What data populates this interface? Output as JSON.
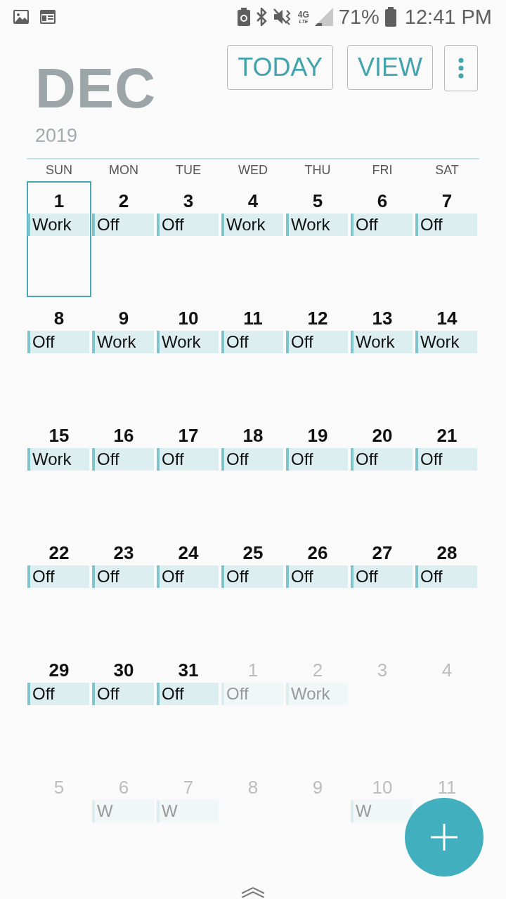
{
  "status_bar": {
    "network_top": "4G",
    "network_bottom": "LTE",
    "battery": "71%",
    "time": "12:41 PM"
  },
  "header": {
    "month": "DEC",
    "year": "2019",
    "buttons": [
      "TODAY",
      "VIEW"
    ]
  },
  "weekdays": [
    "SUN",
    "MON",
    "TUE",
    "WED",
    "THU",
    "FRI",
    "SAT"
  ],
  "weeks": [
    [
      {
        "day": "1",
        "in_month": true,
        "selected": true,
        "event": "Work"
      },
      {
        "day": "2",
        "in_month": true,
        "selected": false,
        "event": "Off"
      },
      {
        "day": "3",
        "in_month": true,
        "selected": false,
        "event": "Off"
      },
      {
        "day": "4",
        "in_month": true,
        "selected": false,
        "event": "Work"
      },
      {
        "day": "5",
        "in_month": true,
        "selected": false,
        "event": "Work"
      },
      {
        "day": "6",
        "in_month": true,
        "selected": false,
        "event": "Off"
      },
      {
        "day": "7",
        "in_month": true,
        "selected": false,
        "event": "Off"
      }
    ],
    [
      {
        "day": "8",
        "in_month": true,
        "selected": false,
        "event": "Off"
      },
      {
        "day": "9",
        "in_month": true,
        "selected": false,
        "event": "Work"
      },
      {
        "day": "10",
        "in_month": true,
        "selected": false,
        "event": "Work"
      },
      {
        "day": "11",
        "in_month": true,
        "selected": false,
        "event": "Off"
      },
      {
        "day": "12",
        "in_month": true,
        "selected": false,
        "event": "Off"
      },
      {
        "day": "13",
        "in_month": true,
        "selected": false,
        "event": "Work"
      },
      {
        "day": "14",
        "in_month": true,
        "selected": false,
        "event": "Work"
      }
    ],
    [
      {
        "day": "15",
        "in_month": true,
        "selected": false,
        "event": "Work"
      },
      {
        "day": "16",
        "in_month": true,
        "selected": false,
        "event": "Off"
      },
      {
        "day": "17",
        "in_month": true,
        "selected": false,
        "event": "Off"
      },
      {
        "day": "18",
        "in_month": true,
        "selected": false,
        "event": "Off"
      },
      {
        "day": "19",
        "in_month": true,
        "selected": false,
        "event": "Off"
      },
      {
        "day": "20",
        "in_month": true,
        "selected": false,
        "event": "Off"
      },
      {
        "day": "21",
        "in_month": true,
        "selected": false,
        "event": "Off"
      }
    ],
    [
      {
        "day": "22",
        "in_month": true,
        "selected": false,
        "event": "Off"
      },
      {
        "day": "23",
        "in_month": true,
        "selected": false,
        "event": "Off"
      },
      {
        "day": "24",
        "in_month": true,
        "selected": false,
        "event": "Off"
      },
      {
        "day": "25",
        "in_month": true,
        "selected": false,
        "event": "Off"
      },
      {
        "day": "26",
        "in_month": true,
        "selected": false,
        "event": "Off"
      },
      {
        "day": "27",
        "in_month": true,
        "selected": false,
        "event": "Off"
      },
      {
        "day": "28",
        "in_month": true,
        "selected": false,
        "event": "Off"
      }
    ],
    [
      {
        "day": "29",
        "in_month": true,
        "selected": false,
        "event": "Off"
      },
      {
        "day": "30",
        "in_month": true,
        "selected": false,
        "event": "Off"
      },
      {
        "day": "31",
        "in_month": true,
        "selected": false,
        "event": "Off"
      },
      {
        "day": "1",
        "in_month": false,
        "selected": false,
        "event": "Off"
      },
      {
        "day": "2",
        "in_month": false,
        "selected": false,
        "event": "Work"
      },
      {
        "day": "3",
        "in_month": false,
        "selected": false
      },
      {
        "day": "4",
        "in_month": false,
        "selected": false
      }
    ],
    [
      {
        "day": "5",
        "in_month": false,
        "selected": false
      },
      {
        "day": "6",
        "in_month": false,
        "selected": false,
        "event": "W"
      },
      {
        "day": "7",
        "in_month": false,
        "selected": false,
        "event": "W"
      },
      {
        "day": "8",
        "in_month": false,
        "selected": false
      },
      {
        "day": "9",
        "in_month": false,
        "selected": false
      },
      {
        "day": "10",
        "in_month": false,
        "selected": false,
        "event": "W"
      },
      {
        "day": "11",
        "in_month": false,
        "selected": false
      }
    ]
  ]
}
